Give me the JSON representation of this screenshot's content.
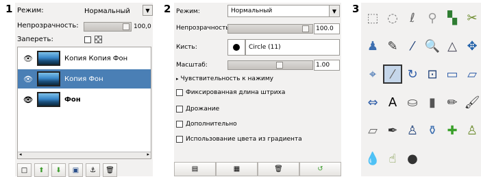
{
  "panel1": {
    "number": "1",
    "mode_label": "Режим:",
    "mode_value": "Нормальный",
    "opacity_label": "Непрозрачность:",
    "opacity_value": "100,0",
    "lock_label": "Запереть:",
    "layers": [
      {
        "name": "Копия Копия Фон",
        "selected": false
      },
      {
        "name": "Копия Фон",
        "selected": true
      },
      {
        "name": "Фон",
        "selected": false
      }
    ]
  },
  "panel2": {
    "number": "2",
    "mode_label": "Режим:",
    "mode_value": "Нормальный",
    "opacity_label": "Непрозрачность",
    "opacity_value": "100.0",
    "brush_label": "Кисть:",
    "brush_value": "Circle (11)",
    "scale_label": "Масштаб:",
    "scale_value": "1.00",
    "pressure_label": "Чувствительность к нажиму",
    "options": [
      "Фиксированная длина штриха",
      "Дрожание",
      "Дополнительно",
      "Использование цвета из градиента"
    ]
  },
  "panel3": {
    "number": "3",
    "tools": [
      "rect-select",
      "ellipse-select",
      "free-select",
      "fuzzy-select",
      "color-select",
      "scissors",
      "foreground-select",
      "paths",
      "color-picker",
      "zoom",
      "measure",
      "move",
      "align",
      "crop",
      "rotate",
      "scale",
      "shear",
      "perspective",
      "flip",
      "text",
      "bucket-fill",
      "blend",
      "pencil",
      "paintbrush",
      "eraser",
      "airbrush",
      "ink",
      "clone",
      "heal",
      "perspective-clone",
      "blur",
      "smudge",
      "dodge-burn"
    ]
  },
  "colors": {
    "selection": "#4a7fb5",
    "panel_bg": "#f2f1f0"
  }
}
